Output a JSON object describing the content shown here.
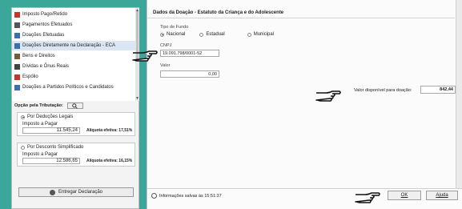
{
  "nav": {
    "items": [
      {
        "label": "Imposto Pago/Retido",
        "icon": "document-icon",
        "color": "#c0392b"
      },
      {
        "label": "Pagamentos Efetuados",
        "icon": "payments-icon",
        "color": "#555555"
      },
      {
        "label": "Doações Efetuadas",
        "icon": "donation-icon",
        "color": "#3a6fb0"
      },
      {
        "label": "Doações Diretamente na Declaração - ECA",
        "icon": "donation-eca-icon",
        "color": "#3a6fb0",
        "selected": true
      },
      {
        "label": "Bens e Direitos",
        "icon": "house-icon",
        "color": "#7a5a3a"
      },
      {
        "label": "Dívidas e Ônus Reais",
        "icon": "debt-icon",
        "color": "#444444"
      },
      {
        "label": "Espólio",
        "icon": "folder-icon",
        "color": "#c0392b"
      },
      {
        "label": "Doações a Partidos Políticos e Candidatos",
        "icon": "party-icon",
        "color": "#3a6fb0"
      }
    ]
  },
  "tributacao": {
    "label": "Opção pela Tributação:"
  },
  "deducoes": {
    "title": "Por Deduções Legais",
    "sub": "Imposto a Pagar",
    "value": "11.545,24",
    "aliquota": "Alíquota efetiva: 17,51%"
  },
  "simplificado": {
    "title": "Por Desconto Simplificado",
    "sub": "Imposto a Pagar",
    "value": "12.586,65",
    "aliquota": "Alíquota efetiva: 16,15%"
  },
  "entregar": {
    "label": "Entregar Declaração"
  },
  "form": {
    "header": "Dados da Doação - Estatuto da Criança e do Adolescente",
    "tipo_label": "Tipo de Fundo",
    "options": [
      "Nacional",
      "Estadual",
      "Municipal"
    ],
    "cnpj_label": "CNPJ",
    "cnpj_value": "19.091.798/0001-52",
    "valor_label": "Valor",
    "valor_value": "0,00",
    "disp_label": "Valor disponível para doação:",
    "disp_value": "842,44"
  },
  "footer": {
    "info": "Informações salvas às 15:51:37",
    "ok_label": "OK",
    "help_label": "Ajuda"
  },
  "colors": {
    "background": "#3aa79a",
    "selected_row": "#dbe6f3"
  }
}
